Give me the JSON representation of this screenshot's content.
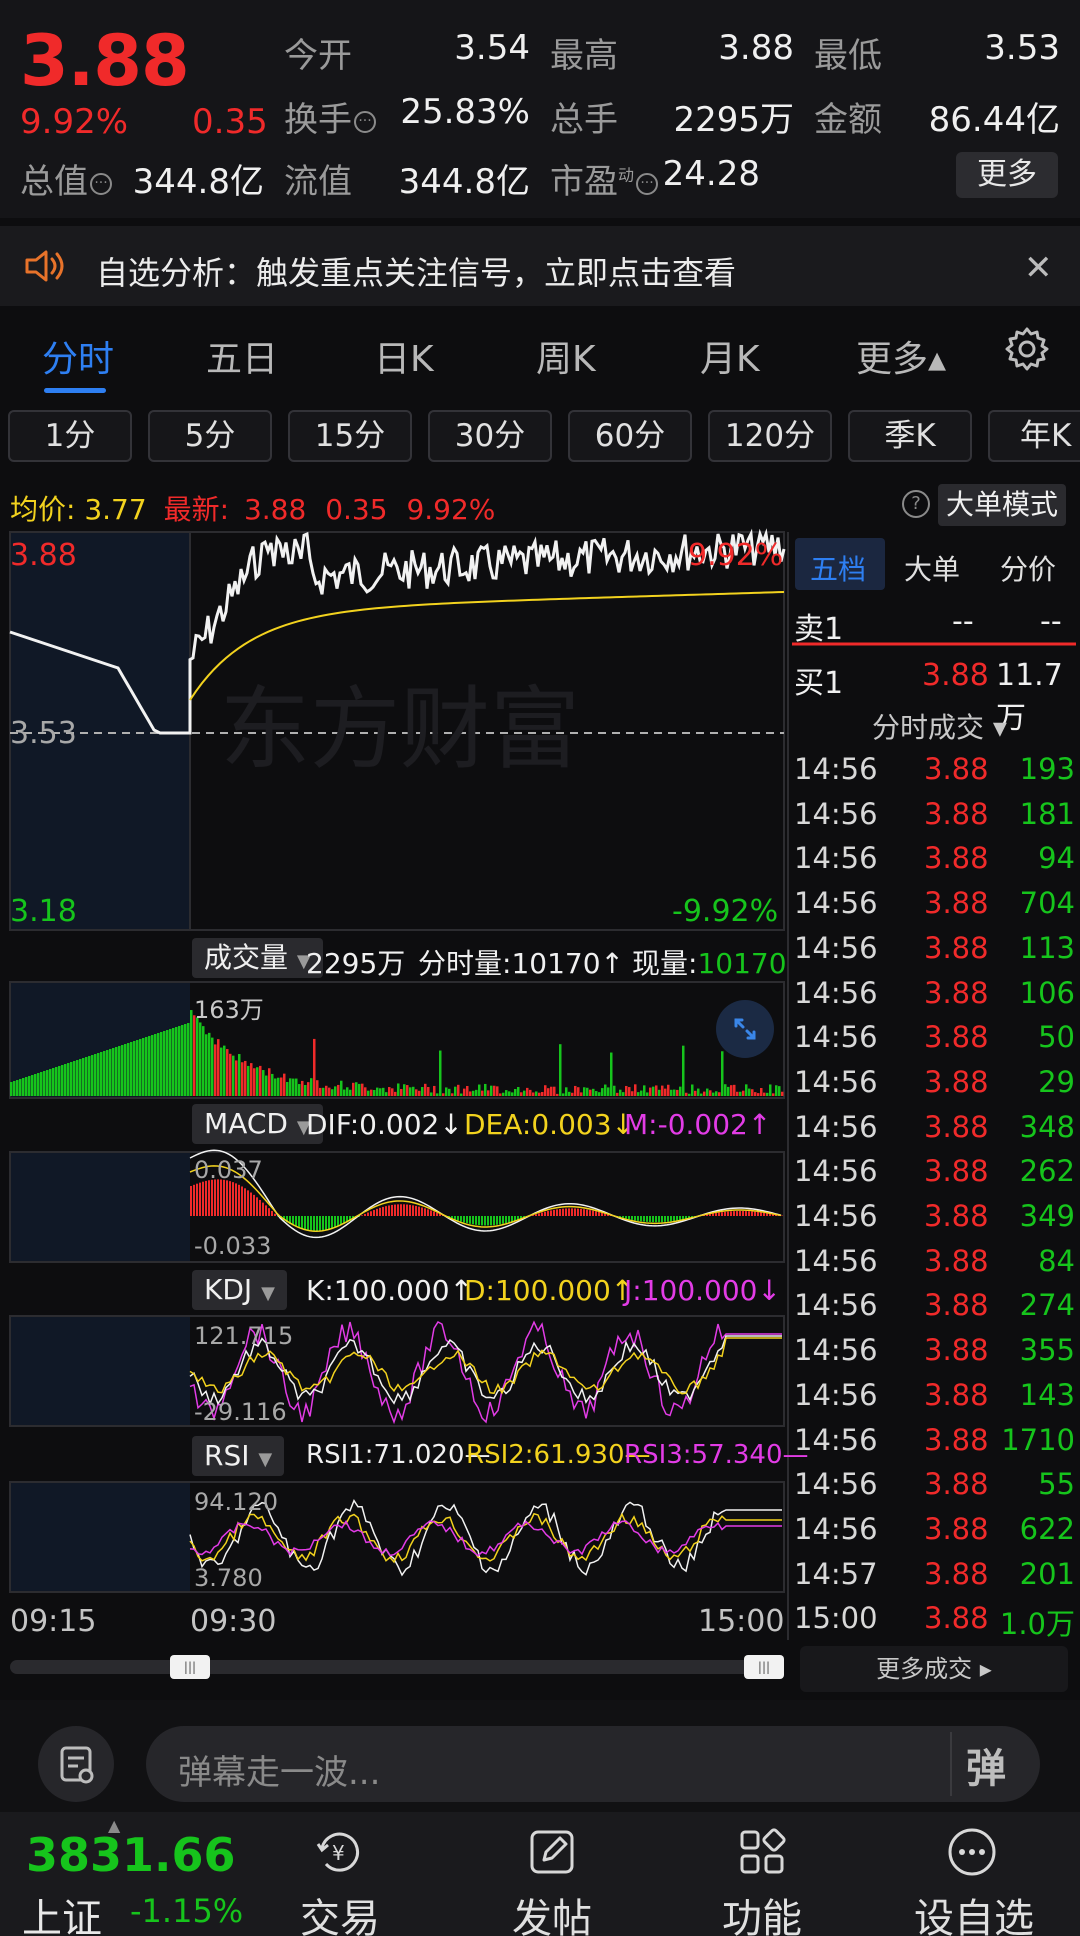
{
  "quote": {
    "price": "3.88",
    "change_pct": "9.92%",
    "change": "0.35",
    "fields": {
      "open_label": "今开",
      "open_value": "3.54",
      "high_label": "最高",
      "high_value": "3.88",
      "low_label": "最低",
      "low_value": "3.53",
      "turnover_label": "换手",
      "turnover_value": "25.83%",
      "volume_label": "总手",
      "volume_value": "2295万",
      "amount_label": "金额",
      "amount_value": "86.44亿",
      "mktcap_label": "总值",
      "mktcap_value": "344.8亿",
      "float_label": "流值",
      "float_value": "344.8亿",
      "pe_label": "市盈",
      "pe_sup": "动",
      "pe_value": "24.28"
    },
    "more_label": "更多"
  },
  "notice": {
    "text": "自选分析：触发重点关注信号，立即点击查看"
  },
  "tabs": [
    "分时",
    "五日",
    "日K",
    "周K",
    "月K",
    "更多▴"
  ],
  "intervals": [
    "1分",
    "5分",
    "15分",
    "30分",
    "60分",
    "120分",
    "季K",
    "年K"
  ],
  "avgline": {
    "avg_label": "均价:",
    "avg_value": "3.77",
    "latest_label": "最新:",
    "latest_value": "3.88",
    "latest_change": "0.35",
    "latest_pct": "9.92%",
    "big_order_label": "大单模式"
  },
  "main_chart": {
    "top_price": "3.88",
    "top_pct": "9.92%",
    "mid_price": "3.53",
    "bottom_price": "3.18",
    "bottom_pct": "-9.92%",
    "watermark": "东方财富"
  },
  "volume_panel": {
    "label": "成交量",
    "total": "2295万",
    "minute_label": "分时量:",
    "minute_value": "10170↑",
    "now_label": "现量:",
    "now_value": "10170",
    "max_label": "163万"
  },
  "macd_panel": {
    "label": "MACD",
    "dif": "DIF:0.002↓",
    "dea": "DEA:0.003↓",
    "m": "M:-0.002↑",
    "top": "0.037",
    "bottom": "-0.033"
  },
  "kdj_panel": {
    "label": "KDJ",
    "k": "K:100.000↑",
    "d": "D:100.000↑",
    "j": "J:100.000↓",
    "top": "121.715",
    "bottom": "-29.116"
  },
  "rsi_panel": {
    "label": "RSI",
    "rsi1": "RSI1:71.020—",
    "rsi2": "RSI2:61.930—",
    "rsi3": "RSI3:57.340—",
    "top": "94.120",
    "bottom": "3.780"
  },
  "time_axis": [
    "09:15",
    "09:30",
    "15:00"
  ],
  "right_panel": {
    "tabs": [
      "五档",
      "大单",
      "分价"
    ],
    "sell1_label": "卖1",
    "sell1_price": "--",
    "sell1_vol": "--",
    "buy1_label": "买1",
    "buy1_price": "3.88",
    "buy1_vol": "11.7万",
    "ticks_header": "分时成交 ▾",
    "ticks": [
      {
        "t": "14:56",
        "p": "3.88",
        "v": "193"
      },
      {
        "t": "14:56",
        "p": "3.88",
        "v": "181"
      },
      {
        "t": "14:56",
        "p": "3.88",
        "v": "94"
      },
      {
        "t": "14:56",
        "p": "3.88",
        "v": "704"
      },
      {
        "t": "14:56",
        "p": "3.88",
        "v": "113"
      },
      {
        "t": "14:56",
        "p": "3.88",
        "v": "106"
      },
      {
        "t": "14:56",
        "p": "3.88",
        "v": "50"
      },
      {
        "t": "14:56",
        "p": "3.88",
        "v": "29"
      },
      {
        "t": "14:56",
        "p": "3.88",
        "v": "348"
      },
      {
        "t": "14:56",
        "p": "3.88",
        "v": "262"
      },
      {
        "t": "14:56",
        "p": "3.88",
        "v": "349"
      },
      {
        "t": "14:56",
        "p": "3.88",
        "v": "84"
      },
      {
        "t": "14:56",
        "p": "3.88",
        "v": "274"
      },
      {
        "t": "14:56",
        "p": "3.88",
        "v": "355"
      },
      {
        "t": "14:56",
        "p": "3.88",
        "v": "143"
      },
      {
        "t": "14:56",
        "p": "3.88",
        "v": "1710"
      },
      {
        "t": "14:56",
        "p": "3.88",
        "v": "55"
      },
      {
        "t": "14:56",
        "p": "3.88",
        "v": "622"
      },
      {
        "t": "14:57",
        "p": "3.88",
        "v": "201"
      },
      {
        "t": "15:00",
        "p": "3.88",
        "v": "1.0万"
      }
    ],
    "more_ticks": "更多成交 ▸"
  },
  "comment": {
    "placeholder": "弹幕走一波...",
    "danmu": "弹"
  },
  "nav": {
    "index_value": "3831.66",
    "index_name": "上证",
    "index_pct": "-1.15%",
    "items": [
      "交易",
      "发帖",
      "功能",
      "设自选"
    ]
  },
  "colors": {
    "up": "#f02a2a",
    "down": "#16c41c",
    "accent": "#2e7ff2",
    "avg_line": "#f2d21e",
    "bg": "#0d0d0f"
  }
}
